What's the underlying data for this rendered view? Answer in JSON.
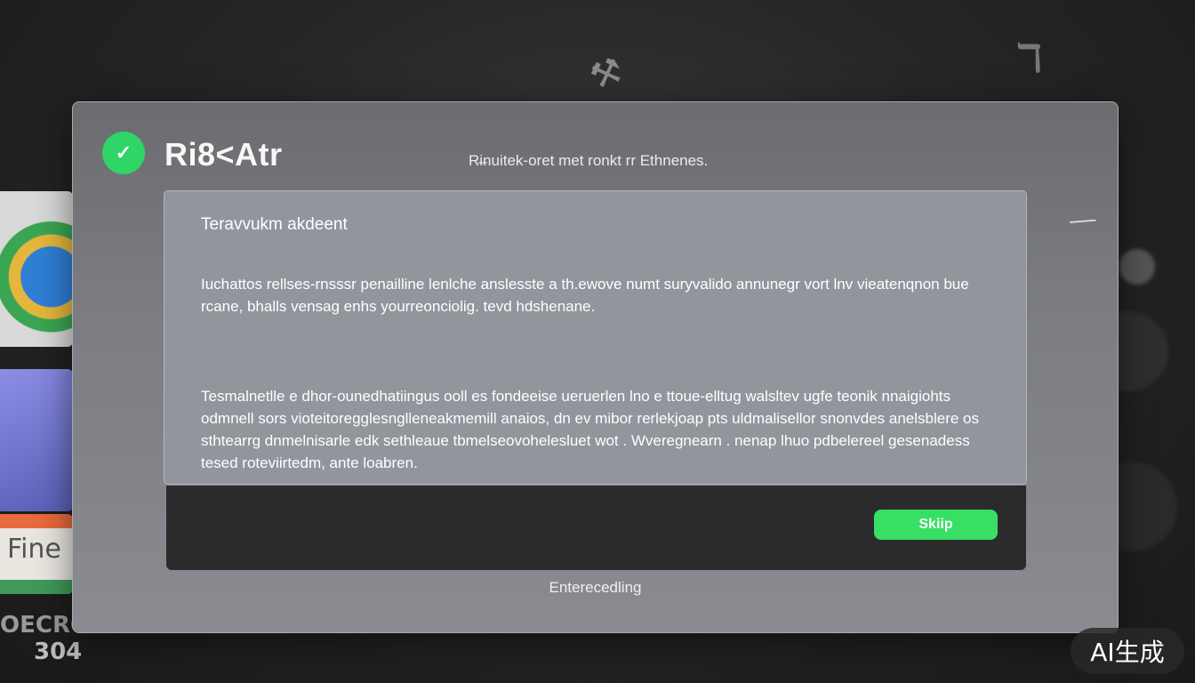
{
  "app": {
    "title": "Ri8<Atr",
    "header_subtitle": "Ri̶nuitek-oret met ronkt rr Ethnenes."
  },
  "panel": {
    "heading": "Teravvukm akdeent",
    "paragraph_1": "Iuchattos rellses-rnsssr penailline lenlche anslesste a th.ewove numt suryvalido annunegr vort lnv vieatenqnon bue rcane, bhalls vensag enhs yourreonciolig. tevd hdshenane.",
    "paragraph_2": "Tesmalnetlle e dhor-ounedhatiingus ooll es fondeeise ueruerlen lno e ttoue-elltug walsltev ugfe teonik nnaigiohts odmnell sors vioteitoregglesnglleneakmemill anaios, dn ev mibor rerlekjoap pts uldmalisellor snonvdes anelsblere os sthtearrg dnmelnisarle edk sethleaue tbmelseovohelesluet wot . Wveregnearn . nenap lhuo pdbelereel gesenadess tesed roteviirtedm, ante loabren."
  },
  "actions": {
    "skip_label": "Skiip"
  },
  "footer": {
    "status": "Enterecedling"
  },
  "background": {
    "tile_label": "Fine",
    "text_line_1": "OECRO",
    "text_line_2": "304"
  },
  "watermark": {
    "label": "AI生成"
  },
  "colors": {
    "accent_green": "#37e064",
    "badge_green": "#2fd566",
    "dialog_bg": "#7c7d82",
    "panel_bg": "#92959c",
    "action_bar_bg": "#2b2b2b"
  },
  "icons": {
    "app_badge": "check-icon",
    "header_right": "pin-icon"
  }
}
